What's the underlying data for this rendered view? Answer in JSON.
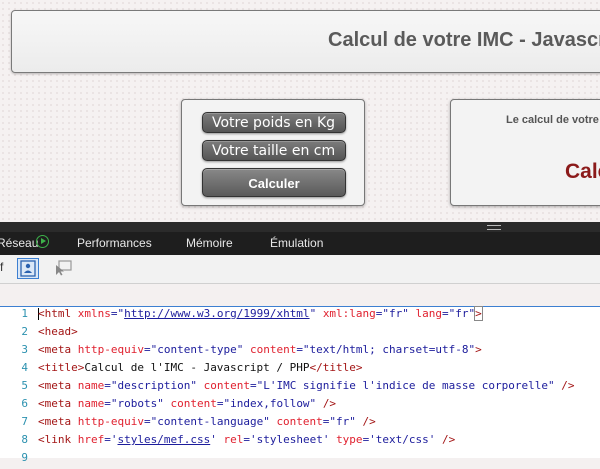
{
  "page": {
    "title": "Calcul de votre IMC - Javascript / PHP",
    "form": {
      "weight_placeholder": "Votre poids en Kg",
      "height_placeholder": "Votre taille en cm",
      "calc_button": "Calculer"
    },
    "result": {
      "text": "Le calcul de votre IMC",
      "value": "Calcul"
    }
  },
  "devtools": {
    "tabs": [
      "Réseau",
      "Performances",
      "Mémoire",
      "Émulation"
    ],
    "toolbar_label": "f",
    "code_lines": [
      {
        "n": "1"
      },
      {
        "n": "2"
      },
      {
        "n": "3"
      },
      {
        "n": "4"
      },
      {
        "n": "5"
      },
      {
        "n": "6"
      },
      {
        "n": "7"
      },
      {
        "n": "8"
      },
      {
        "n": "9"
      }
    ],
    "code": {
      "l1_a": "<html ",
      "l1_b": "xmlns",
      "l1_c": "=\"",
      "l1_url": "http://www.w3.org/1999/xhtml",
      "l1_d": "\" ",
      "l1_e": "xml:lang",
      "l1_f": "=\"fr\" ",
      "l1_g": "lang",
      "l1_h": "=\"fr\"",
      "l1_i": ">",
      "l2": "<head>",
      "l3_a": "<meta ",
      "l3_b": "http-equiv",
      "l3_c": "=\"content-type\" ",
      "l3_d": "content",
      "l3_e": "=\"text/html; charset=utf-8\"",
      "l3_f": ">",
      "l4_a": "<title>",
      "l4_b": "Calcul de l'IMC - Javascript / PHP",
      "l4_c": "</title>",
      "l5_a": "<meta ",
      "l5_b": "name",
      "l5_c": "=\"description\" ",
      "l5_d": "content",
      "l5_e": "=\"L'IMC signifie l'indice de masse corporelle\" ",
      "l5_f": "/>",
      "l6_a": "<meta ",
      "l6_b": "name",
      "l6_c": "=\"robots\" ",
      "l6_d": "content",
      "l6_e": "=\"index,follow\" ",
      "l6_f": "/>",
      "l7_a": "<meta ",
      "l7_b": "http-equiv",
      "l7_c": "=\"content-language\" ",
      "l7_d": "content",
      "l7_e": "=\"fr\" ",
      "l7_f": "/>",
      "l8_a": "<link ",
      "l8_b": "href",
      "l8_c": "='",
      "l8_url": "styles/mef.css",
      "l8_d": "' ",
      "l8_e": "rel",
      "l8_f": "='stylesheet' ",
      "l8_g": "type",
      "l8_h": "='text/css' ",
      "l8_i": "/>"
    }
  },
  "colors": {
    "result_value": "#8b1a1a",
    "line_numbers": "#2b91af",
    "tag": "#a31515",
    "attribute": "#e0212f",
    "value": "#1c1c9c",
    "devtools_tabs_bg": "#1e1e1e",
    "accent": "#3c7fd1"
  }
}
